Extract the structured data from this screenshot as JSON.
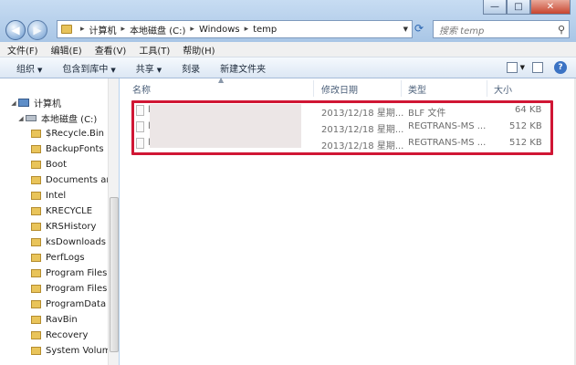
{
  "window": {
    "minimize": "—",
    "maximize": "□",
    "close": "✕"
  },
  "address": {
    "crumbs": [
      "计算机",
      "本地磁盘 (C:)",
      "Windows",
      "temp"
    ],
    "search_placeholder": "搜索 temp"
  },
  "menu": [
    "文件(F)",
    "编辑(E)",
    "查看(V)",
    "工具(T)",
    "帮助(H)"
  ],
  "commands": [
    "组织",
    "包含到库中",
    "共享",
    "刻录",
    "新建文件夹"
  ],
  "tree": [
    {
      "label": "计算机",
      "type": "pc"
    },
    {
      "label": "本地磁盘 (C:)",
      "type": "drive"
    },
    {
      "label": "$Recycle.Bin",
      "type": "folder"
    },
    {
      "label": "BackupFonts",
      "type": "folder"
    },
    {
      "label": "Boot",
      "type": "folder"
    },
    {
      "label": "Documents and",
      "type": "folder"
    },
    {
      "label": "Intel",
      "type": "folder"
    },
    {
      "label": "KRECYCLE",
      "type": "folder"
    },
    {
      "label": "KRSHistory",
      "type": "folder"
    },
    {
      "label": "ksDownloads",
      "type": "folder"
    },
    {
      "label": "PerfLogs",
      "type": "folder"
    },
    {
      "label": "Program Files",
      "type": "folder"
    },
    {
      "label": "Program Files (",
      "type": "folder"
    },
    {
      "label": "ProgramData",
      "type": "folder"
    },
    {
      "label": "RavBin",
      "type": "folder"
    },
    {
      "label": "Recovery",
      "type": "folder"
    },
    {
      "label": "System Volume",
      "type": "folder"
    }
  ],
  "columns": {
    "name": "名称",
    "modified": "修改日期",
    "type": "类型",
    "size": "大小"
  },
  "files": [
    {
      "name": "l",
      "modified": "2013/12/18 星期...",
      "type": "BLF 文件",
      "size": "64 KB"
    },
    {
      "name": "l",
      "modified": "2013/12/18 星期...",
      "type": "REGTRANS-MS ...",
      "size": "512 KB"
    },
    {
      "name": "l",
      "modified": "2013/12/18 星期...",
      "type": "REGTRANS-MS ...",
      "size": "512 KB"
    }
  ],
  "colors": {
    "highlight": "#d01634",
    "redaction": "#ece6e6"
  }
}
